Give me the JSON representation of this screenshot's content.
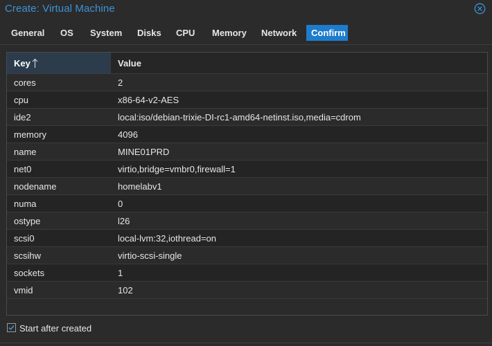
{
  "window": {
    "title": "Create: Virtual Machine"
  },
  "tabs": [
    {
      "label": "General"
    },
    {
      "label": "OS"
    },
    {
      "label": "System"
    },
    {
      "label": "Disks"
    },
    {
      "label": "CPU"
    },
    {
      "label": "Memory"
    },
    {
      "label": "Network"
    },
    {
      "label": "Confirm"
    }
  ],
  "active_tab": "Confirm",
  "grid": {
    "key_header": "Key",
    "value_header": "Value",
    "sort": "ascending",
    "rows": [
      {
        "key": "cores",
        "value": "2"
      },
      {
        "key": "cpu",
        "value": "x86-64-v2-AES"
      },
      {
        "key": "ide2",
        "value": "local:iso/debian-trixie-DI-rc1-amd64-netinst.iso,media=cdrom"
      },
      {
        "key": "memory",
        "value": "4096"
      },
      {
        "key": "name",
        "value": "MINE01PRD"
      },
      {
        "key": "net0",
        "value": "virtio,bridge=vmbr0,firewall=1"
      },
      {
        "key": "nodename",
        "value": "homelabv1"
      },
      {
        "key": "numa",
        "value": "0"
      },
      {
        "key": "ostype",
        "value": "l26"
      },
      {
        "key": "scsi0",
        "value": "local-lvm:32,iothread=on"
      },
      {
        "key": "scsihw",
        "value": "virtio-scsi-single"
      },
      {
        "key": "sockets",
        "value": "1"
      },
      {
        "key": "vmid",
        "value": "102"
      }
    ]
  },
  "footer": {
    "start_after_created_label": "Start after created",
    "start_after_created_checked": true
  },
  "colors": {
    "accent": "#1e7ccd",
    "title": "#3d93d7",
    "background": "#2b2b2b"
  }
}
